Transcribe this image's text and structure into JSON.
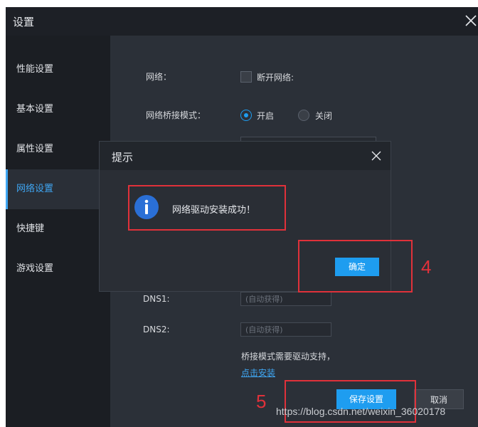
{
  "window": {
    "title": "设置"
  },
  "sidebar": {
    "items": [
      {
        "label": "性能设置"
      },
      {
        "label": "基本设置"
      },
      {
        "label": "属性设置"
      },
      {
        "label": "网络设置",
        "active": true
      },
      {
        "label": "快捷键"
      },
      {
        "label": "游戏设置"
      }
    ]
  },
  "network": {
    "label": "网络：",
    "disconnect_label": "断开网络:",
    "disconnect_checked": false
  },
  "bridge": {
    "label": "网络桥接模式：",
    "options": [
      {
        "label": "开启",
        "selected": true
      },
      {
        "label": "关闭",
        "selected": false
      }
    ]
  },
  "dns": {
    "dns1_label": "DNS1:",
    "dns1_placeholder": "(自动获得)",
    "dns2_label": "DNS2:",
    "dns2_placeholder": "(自动获得)"
  },
  "bridge_note": "桥接模式需要驱动支持，",
  "install_link": "点击安装",
  "footer": {
    "save_label": "保存设置",
    "cancel_label": "取消"
  },
  "dialog": {
    "title": "提示",
    "message": "网络驱动安装成功！",
    "ok_label": "确定"
  },
  "annotations": {
    "step4": "4",
    "step5": "5",
    "color": "#e0313a"
  },
  "watermark": "https://blog.csdn.net/weixin_36020178",
  "colors": {
    "accent": "#1e9df0",
    "window_bg": "#23272e",
    "sidebar_bg": "#1b1e23"
  },
  "icons": {
    "window_close": "close-icon",
    "dialog_close": "close-icon",
    "dialog_info": "info-icon"
  }
}
